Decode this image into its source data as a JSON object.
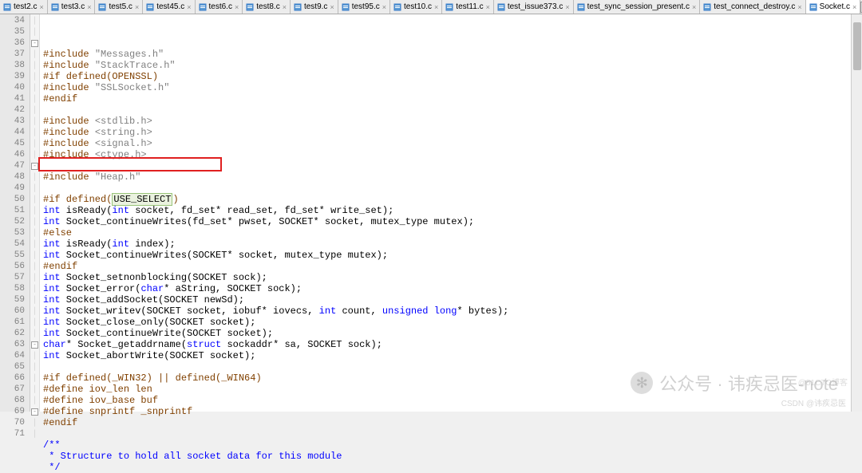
{
  "tabs": [
    {
      "label": "test2.c"
    },
    {
      "label": "test3.c"
    },
    {
      "label": "test5.c"
    },
    {
      "label": "test45.c"
    },
    {
      "label": "test6.c"
    },
    {
      "label": "test8.c"
    },
    {
      "label": "test9.c"
    },
    {
      "label": "test95.c"
    },
    {
      "label": "test10.c"
    },
    {
      "label": "test11.c"
    },
    {
      "label": "test_issue373.c"
    },
    {
      "label": "test_sync_session_present.c"
    },
    {
      "label": "test_connect_destroy.c"
    },
    {
      "label": "Socket.c",
      "active": true
    }
  ],
  "nav": {
    "left": "◂",
    "right": "▸",
    "close": "✕"
  },
  "line_start": 34,
  "fold": {
    "36": "-",
    "47": "-",
    "63": "-",
    "69": "-"
  },
  "code": {
    "34": [
      [
        "pp",
        "#include "
      ],
      [
        "str",
        "\"Messages.h\""
      ]
    ],
    "35": [
      [
        "pp",
        "#include "
      ],
      [
        "str",
        "\"StackTrace.h\""
      ]
    ],
    "36": [
      [
        "pp",
        "#if defined(OPENSSL)"
      ]
    ],
    "37": [
      [
        "pp",
        "#include "
      ],
      [
        "str",
        "\"SSLSocket.h\""
      ]
    ],
    "38": [
      [
        "pp",
        "#endif"
      ]
    ],
    "39": [
      [
        "",
        ""
      ]
    ],
    "40": [
      [
        "pp",
        "#include "
      ],
      [
        "str",
        "<stdlib.h>"
      ]
    ],
    "41": [
      [
        "pp",
        "#include "
      ],
      [
        "str",
        "<string.h>"
      ]
    ],
    "42": [
      [
        "pp",
        "#include "
      ],
      [
        "str",
        "<signal.h>"
      ]
    ],
    "43": [
      [
        "pp",
        "#include "
      ],
      [
        "str",
        "<ctype.h>"
      ]
    ],
    "44": [
      [
        "",
        ""
      ]
    ],
    "45": [
      [
        "pp",
        "#include "
      ],
      [
        "str",
        "\"Heap.h\""
      ]
    ],
    "46": [
      [
        "",
        ""
      ]
    ],
    "47": [
      [
        "pp",
        "#if defined("
      ],
      [
        "hl",
        "USE_SELECT"
      ],
      [
        "pp",
        ")"
      ]
    ],
    "48": [
      [
        "kw",
        "int"
      ],
      [
        "",
        " isReady("
      ],
      [
        "kw",
        "int"
      ],
      [
        "",
        " socket, fd_set* read_set, fd_set* write_set);"
      ]
    ],
    "49": [
      [
        "kw",
        "int"
      ],
      [
        "",
        " Socket_continueWrites(fd_set* pwset, SOCKET* socket, mutex_type mutex);"
      ]
    ],
    "50": [
      [
        "pp",
        "#else"
      ]
    ],
    "51": [
      [
        "kw",
        "int"
      ],
      [
        "",
        " isReady("
      ],
      [
        "kw",
        "int"
      ],
      [
        "",
        " index);"
      ]
    ],
    "52": [
      [
        "kw",
        "int"
      ],
      [
        "",
        " Socket_continueWrites(SOCKET* socket, mutex_type mutex);"
      ]
    ],
    "53": [
      [
        "pp",
        "#endif"
      ]
    ],
    "54": [
      [
        "kw",
        "int"
      ],
      [
        "",
        " Socket_setnonblocking(SOCKET sock);"
      ]
    ],
    "55": [
      [
        "kw",
        "int"
      ],
      [
        "",
        " Socket_error("
      ],
      [
        "kw",
        "char"
      ],
      [
        "",
        "* aString, SOCKET sock);"
      ]
    ],
    "56": [
      [
        "kw",
        "int"
      ],
      [
        "",
        " Socket_addSocket(SOCKET newSd);"
      ]
    ],
    "57": [
      [
        "kw",
        "int"
      ],
      [
        "",
        " Socket_writev(SOCKET socket, iobuf* iovecs, "
      ],
      [
        "kw",
        "int"
      ],
      [
        "",
        " count, "
      ],
      [
        "kw",
        "unsigned long"
      ],
      [
        "",
        "* bytes);"
      ]
    ],
    "58": [
      [
        "kw",
        "int"
      ],
      [
        "",
        " Socket_close_only(SOCKET socket);"
      ]
    ],
    "59": [
      [
        "kw",
        "int"
      ],
      [
        "",
        " Socket_continueWrite(SOCKET socket);"
      ]
    ],
    "60": [
      [
        "kw",
        "char"
      ],
      [
        "",
        "* Socket_getaddrname("
      ],
      [
        "kw",
        "struct"
      ],
      [
        "",
        " sockaddr* sa, SOCKET sock);"
      ]
    ],
    "61": [
      [
        "kw",
        "int"
      ],
      [
        "",
        " Socket_abortWrite(SOCKET socket);"
      ]
    ],
    "62": [
      [
        "",
        ""
      ]
    ],
    "63": [
      [
        "pp",
        "#if defined(_WIN32) || defined(_WIN64)"
      ]
    ],
    "64": [
      [
        "pp",
        "#define iov_len len"
      ]
    ],
    "65": [
      [
        "pp",
        "#define iov_base buf"
      ]
    ],
    "66": [
      [
        "pp",
        "#define snprintf _snprintf"
      ]
    ],
    "67": [
      [
        "pp",
        "#endif"
      ]
    ],
    "68": [
      [
        "",
        ""
      ]
    ],
    "69": [
      [
        "kw",
        "/**"
      ]
    ],
    "70": [
      [
        "kw",
        " * Structure to hold all socket data for this module"
      ]
    ],
    "71": [
      [
        "kw",
        " */"
      ]
    ]
  },
  "watermark": {
    "prefix": "公众号 · ",
    "name": "讳疾忌医-note"
  },
  "wm2": "CSDN @讳疾忌医",
  "wm3": "@51CTO博客"
}
